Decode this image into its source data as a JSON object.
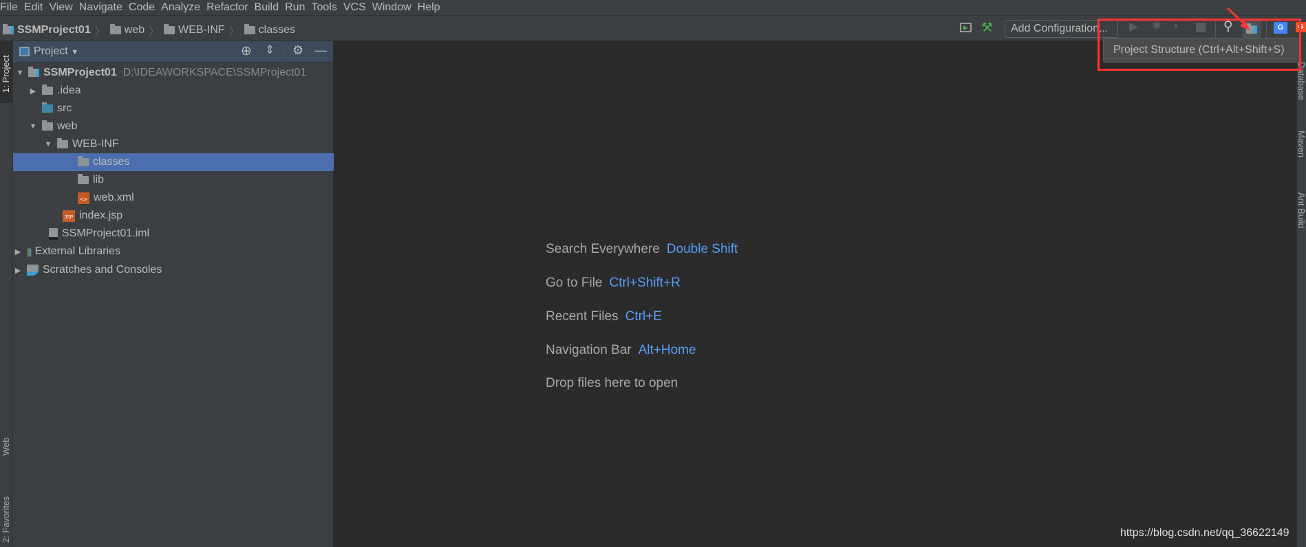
{
  "menu": [
    "File",
    "Edit",
    "View",
    "Navigate",
    "Code",
    "Analyze",
    "Refactor",
    "Build",
    "Run",
    "Tools",
    "VCS",
    "Window",
    "Help"
  ],
  "breadcrumb": [
    "SSMProject01",
    "web",
    "WEB-INF",
    "classes"
  ],
  "toolbar": {
    "add_config": "Add Configuration...",
    "tooltip": "Project Structure (Ctrl+Alt+Shift+S)"
  },
  "panel": {
    "title": "Project"
  },
  "tree": [
    {
      "label": "SSMProject01",
      "path": "D:\\IDEAWORKSPACE\\SSMProject01"
    },
    {
      "label": ".idea"
    },
    {
      "label": "src"
    },
    {
      "label": "web"
    },
    {
      "label": "WEB-INF"
    },
    {
      "label": "classes"
    },
    {
      "label": "lib"
    },
    {
      "label": "web.xml"
    },
    {
      "label": "index.jsp"
    },
    {
      "label": "SSMProject01.iml"
    },
    {
      "label": "External Libraries"
    },
    {
      "label": "Scratches and Consoles"
    }
  ],
  "left_tools": [
    "1: Project",
    "Web",
    "2: Favorites"
  ],
  "right_tools": [
    "Database",
    "Maven",
    "Ant Build"
  ],
  "hints": [
    {
      "label": "Search Everywhere",
      "key": "Double Shift"
    },
    {
      "label": "Go to File",
      "key": "Ctrl+Shift+R"
    },
    {
      "label": "Recent Files",
      "key": "Ctrl+E"
    },
    {
      "label": "Navigation Bar",
      "key": "Alt+Home"
    },
    {
      "label": "Drop files here to open",
      "key": ""
    }
  ],
  "watermark": "https://blog.csdn.net/qq_36622149",
  "colors": {
    "selection": "#4b6eaf",
    "shortcut": "#589df6",
    "highlight_box": "#ff3333"
  }
}
